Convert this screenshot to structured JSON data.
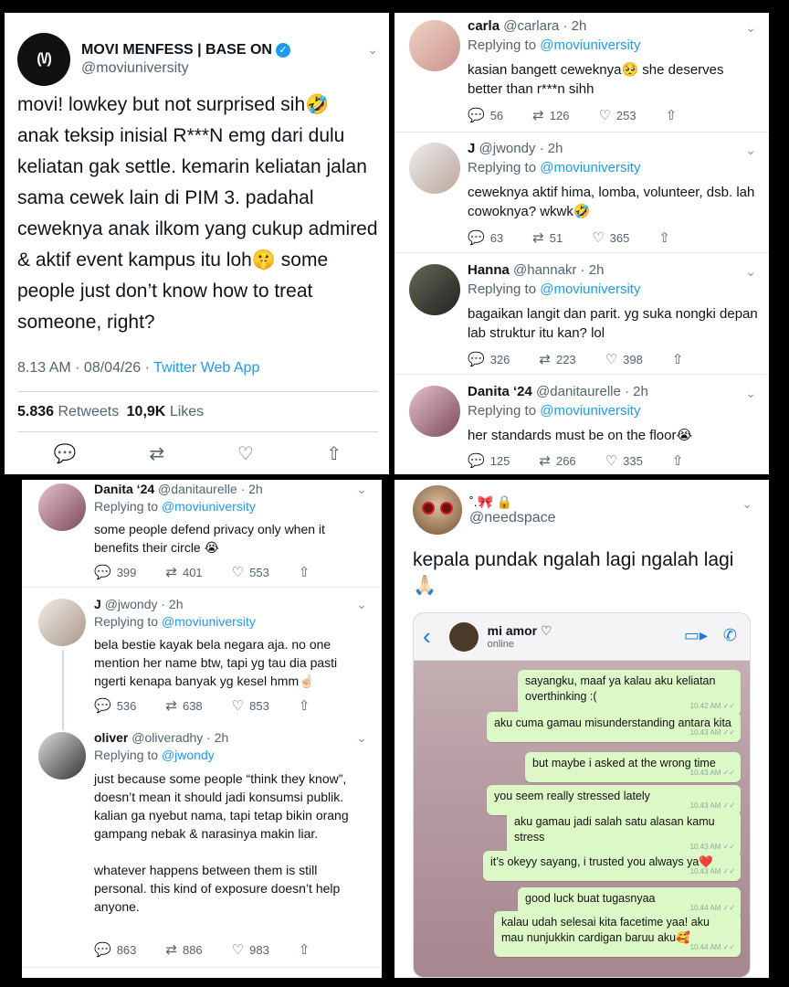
{
  "main_tweet": {
    "avatar_text": "(\\/)",
    "name": "MOVI MENFESS | BASE ON",
    "handle": "@moviuniversity",
    "text": "movi! lowkey but not surprised sih🤣\nanak teksip inisial R***N emg dari dulu keliatan gak settle. kemarin keliatan jalan sama cewek lain di PIM 3. padahal ceweknya anak ilkom yang cukup admired & aktif event kampus itu loh🤫 some people just don’t know how to treat someone, right?",
    "time": "8.13 AM · 08/04/26 · ",
    "source": "Twitter Web App",
    "retweets_count": "5.836",
    "retweets_label": "Retweets",
    "likes_count": "10,9K",
    "likes_label": "Likes"
  },
  "replies_top": [
    {
      "name": "carla",
      "handle": "@carlara · 2h",
      "replying": "Replying to ",
      "to": "@moviuniversity",
      "text": "kasian bangett ceweknya🥺 she deserves better than r***n sihh",
      "comments": "56",
      "retweets": "126",
      "likes": "253"
    },
    {
      "name": "J",
      "handle": "@jwondy · 2h",
      "replying": "Replying to ",
      "to": "@moviuniversity",
      "text": "ceweknya aktif hima, lomba, volunteer, dsb. lah cowoknya? wkwk🤣",
      "comments": "63",
      "retweets": "51",
      "likes": "365"
    },
    {
      "name": "Hanna",
      "handle": "@hannakr · 2h",
      "replying": "Replying to ",
      "to": "@moviuniversity",
      "text": "bagaikan langit dan parit. yg suka nongki depan lab struktur itu kan? lol",
      "comments": "326",
      "retweets": "223",
      "likes": "398"
    },
    {
      "name": "Danita ‘24",
      "handle": "@danitaurelle · 2h",
      "replying": "Replying to ",
      "to": "@moviuniversity",
      "text": "her standards must be on the floor😭",
      "comments": "125",
      "retweets": "266",
      "likes": "335"
    }
  ],
  "replies_bottom": [
    {
      "name": "Danita ‘24",
      "handle": "@danitaurelle · 2h",
      "replying": "Replying to ",
      "to": "@moviuniversity",
      "text": "some people defend privacy only when it benefits their circle 😭",
      "comments": "399",
      "retweets": "401",
      "likes": "553"
    },
    {
      "name": "J",
      "handle": "@jwondy · 2h",
      "replying": "Replying to ",
      "to": "@moviuniversity",
      "text": "bela bestie kayak bela negara aja. no one mention her name btw, tapi yg tau dia pasti ngerti kenapa banyak yg kesel hmm☝🏻",
      "comments": "536",
      "retweets": "638",
      "likes": "853"
    },
    {
      "name": "oliver",
      "handle": "@oliveradhy · 2h",
      "replying": "Replying to ",
      "to": "@jwondy",
      "text": "just because some people “think they know”, doesn’t mean it should jadi konsumsi publik. kalian ga nyebut nama, tapi tetap bikin orang gampang nebak & narasinya makin liar.\n\nwhatever happens between them is still personal. this kind of exposure doesn’t help anyone.",
      "comments": "863",
      "retweets": "886",
      "likes": "983"
    }
  ],
  "needspace": {
    "name": "˚.🎀 🔒",
    "handle": "@needspace",
    "text": "kepala pundak ngalah lagi ngalah lagi 🙏🏻",
    "chat": {
      "contact": "mi amor ♡",
      "status": "online",
      "messages": [
        {
          "text": "sayangku, maaf ya kalau aku keliatan overthinking :(",
          "time": "10.42 AM ✓✓"
        },
        {
          "text": "aku cuma gamau misunderstanding antara kita",
          "time": "10.43 AM ✓✓"
        },
        {
          "text": "but maybe i asked at the wrong time",
          "time": "10.43 AM ✓✓"
        },
        {
          "text": "you seem really stressed lately",
          "time": "10.43 AM ✓✓"
        },
        {
          "text": "aku gamau jadi salah satu alasan kamu stress",
          "time": "10.43 AM ✓✓"
        },
        {
          "text": "it’s okeyy sayang, i trusted you always ya❤️",
          "time": "10.43 AM ✓✓"
        },
        {
          "text": "good luck buat tugasnyaa",
          "time": "10.44 AM ✓✓"
        },
        {
          "text": "kalau udah selesai kita facetime yaa! aku mau nunjukkin cardigan baruu aku🥰",
          "time": "10.44 AM ✓✓"
        }
      ]
    }
  },
  "icons": {
    "reply": "reply-icon",
    "retweet": "retweet-icon",
    "like": "heart-icon",
    "share": "share-icon"
  }
}
